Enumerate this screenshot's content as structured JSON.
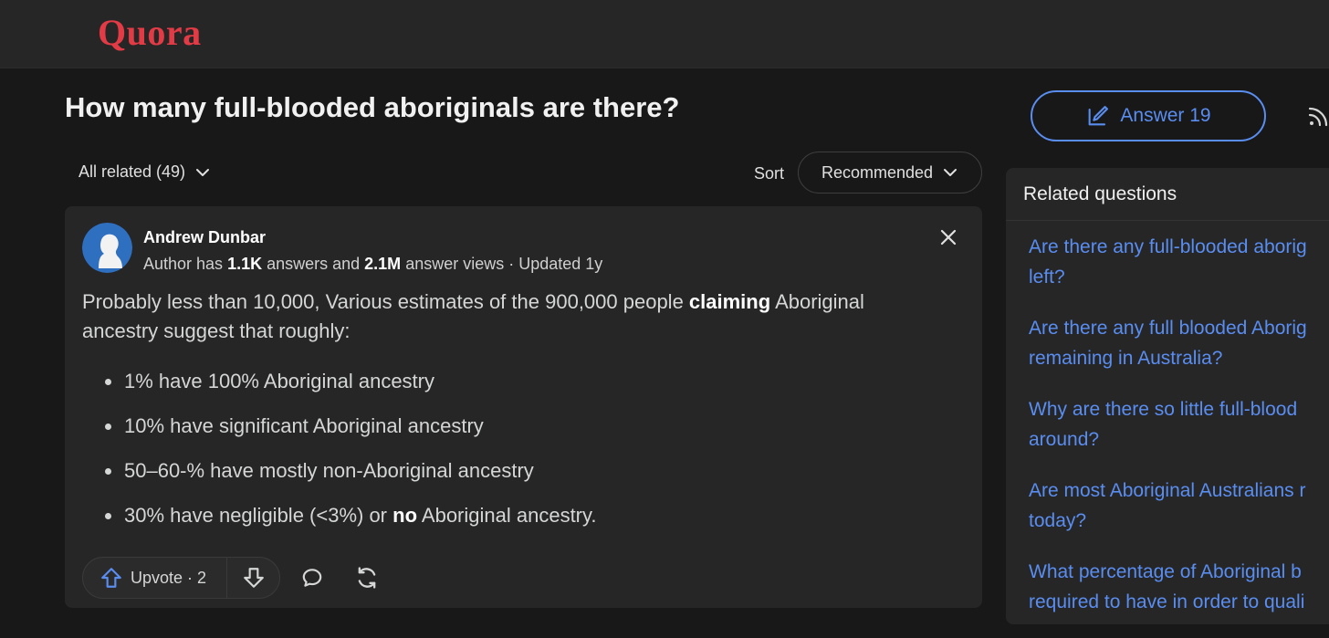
{
  "brand": {
    "name": "Quora",
    "color": "#e23b45"
  },
  "question": {
    "title": "How many full-blooded aboriginals are there?"
  },
  "actions": {
    "answer_label": "Answer 19",
    "follow_icon": "rss-icon"
  },
  "filter": {
    "label": "All related (49)",
    "sort_label": "Sort",
    "sort_value": "Recommended"
  },
  "answer": {
    "author": {
      "name": "Andrew Dunbar",
      "meta_prefix": "Author has ",
      "answers_count": "1.1K",
      "meta_middle": " answers and ",
      "views_count": "2.1M",
      "meta_suffix": " answer views · Updated 1y"
    },
    "body": {
      "p1": "Probably less than 10,000, Various estimates of the 900,000 people ",
      "p1_bold": "claiming",
      "p2": " Aboriginal ancestry suggest that roughly:"
    },
    "bullets": {
      "b1": "1% have 100% Aboriginal ancestry",
      "b2": "10% have significant Aboriginal ancestry",
      "b3": "50–60-% have mostly non-Aboriginal ancestry",
      "b4_pre": "30% have negligible (<3%) or ",
      "b4_bold": "no",
      "b4_post": " Aboriginal ancestry."
    },
    "upvote_label": "Upvote · 2"
  },
  "related": {
    "title": "Related questions",
    "items": [
      {
        "line1": "Are there any full-blooded aborig",
        "line2": "left?"
      },
      {
        "line1": "Are there any full blooded Aborig",
        "line2": "remaining in Australia?"
      },
      {
        "line1": "Why are there so little full-blood",
        "line2": "around?"
      },
      {
        "line1": "Are most Aboriginal Australians r",
        "line2": "today?"
      },
      {
        "line1": "What percentage of Aboriginal b",
        "line2": "required to have in order to quali"
      }
    ]
  },
  "colors": {
    "link": "#5a8df0",
    "background": "#181818",
    "card": "#262626"
  }
}
